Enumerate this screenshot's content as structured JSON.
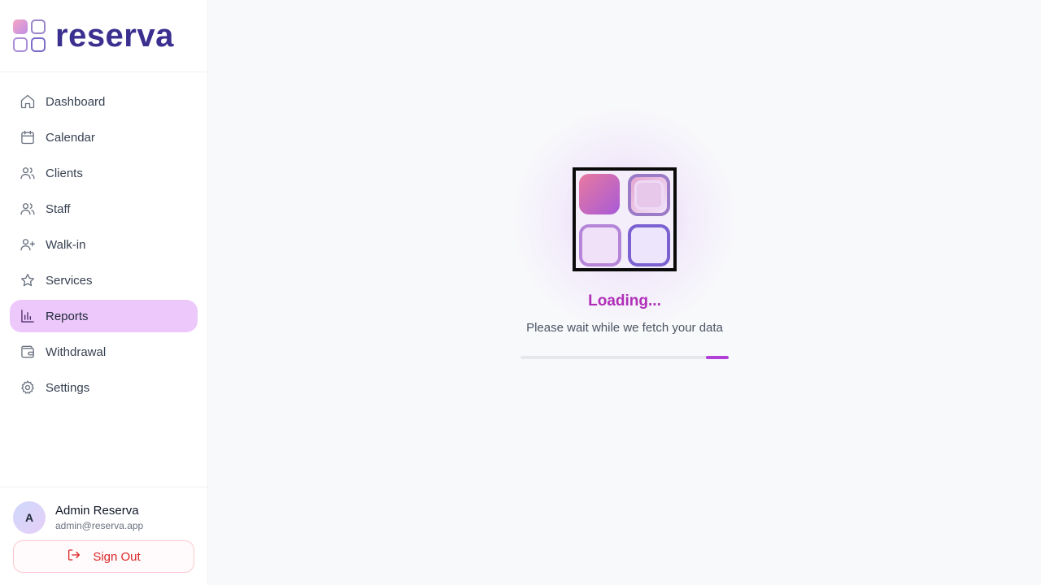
{
  "brand": {
    "name": "reserva",
    "icon": "reserva-logo-icon"
  },
  "sidebar": {
    "items": [
      {
        "label": "Dashboard",
        "icon": "home-icon",
        "active": false
      },
      {
        "label": "Calendar",
        "icon": "calendar-icon",
        "active": false
      },
      {
        "label": "Clients",
        "icon": "users-icon",
        "active": false
      },
      {
        "label": "Staff",
        "icon": "users-icon",
        "active": false
      },
      {
        "label": "Walk-in",
        "icon": "user-plus-icon",
        "active": false
      },
      {
        "label": "Services",
        "icon": "star-icon",
        "active": false
      },
      {
        "label": "Reports",
        "icon": "bar-chart-icon",
        "active": true
      },
      {
        "label": "Withdrawal",
        "icon": "wallet-icon",
        "active": false
      },
      {
        "label": "Settings",
        "icon": "gear-icon",
        "active": false
      }
    ]
  },
  "user": {
    "initial": "A",
    "name": "Admin Reserva",
    "email": "admin@reserva.app",
    "signout_label": "Sign Out"
  },
  "loading": {
    "title": "Loading...",
    "subtitle": "Please wait while we fetch your data",
    "progress": {
      "start_fraction": 0.89,
      "end_fraction": 1.0
    }
  },
  "colors": {
    "accent": "#b040d8",
    "active_nav_bg": "#ecc8fb",
    "brand_text": "#3b2f8f",
    "danger": "#dc2626"
  }
}
